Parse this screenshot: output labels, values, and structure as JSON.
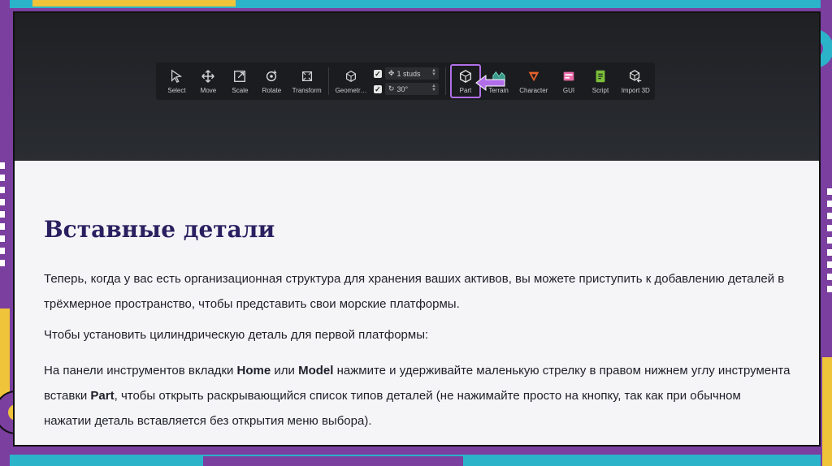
{
  "toolbar": {
    "tools": [
      {
        "label": "Select",
        "icon": "cursor-icon"
      },
      {
        "label": "Move",
        "icon": "move-icon"
      },
      {
        "label": "Scale",
        "icon": "scale-icon"
      },
      {
        "label": "Rotate",
        "icon": "rotate-icon"
      },
      {
        "label": "Transform",
        "icon": "transform-icon"
      },
      {
        "label": "Geometr…",
        "icon": "geometry-icon"
      }
    ],
    "snap_move_value": "1 studs",
    "snap_rotate_value": "30°",
    "insert_tools": [
      {
        "label": "Part",
        "icon": "part-cube-icon"
      },
      {
        "label": "Terrain",
        "icon": "terrain-icon"
      },
      {
        "label": "Character",
        "icon": "character-icon"
      },
      {
        "label": "GUI",
        "icon": "gui-icon"
      },
      {
        "label": "Script",
        "icon": "script-icon"
      },
      {
        "label": "Import 3D",
        "icon": "import-3d-icon"
      }
    ]
  },
  "content": {
    "title": "Вставные детали",
    "p1": "Теперь, когда у вас есть организационная структура для хранения ваших активов, вы можете приступить к добавлению деталей в трёхмерное пространство, чтобы представить свои морские платформы.",
    "p2": "Чтобы установить цилиндрическую деталь для первой платформы:",
    "p3_a": "На панели инструментов вкладки ",
    "p3_home": "Home",
    "p3_b": " или ",
    "p3_model": "Model",
    "p3_c": " нажмите и удерживайте маленькую стрелку в правом нижнем углу инструмента вставки ",
    "p3_part": "Part",
    "p3_d": ", чтобы открыть раскрывающийся список типов деталей (не нажимайте просто на кнопку, так как при обычном нажатии деталь вставляется без открытия меню выбора)."
  },
  "colors": {
    "accent": "#b06fe8",
    "frame_purple": "#7b3fa0",
    "title": "#2a2060"
  }
}
